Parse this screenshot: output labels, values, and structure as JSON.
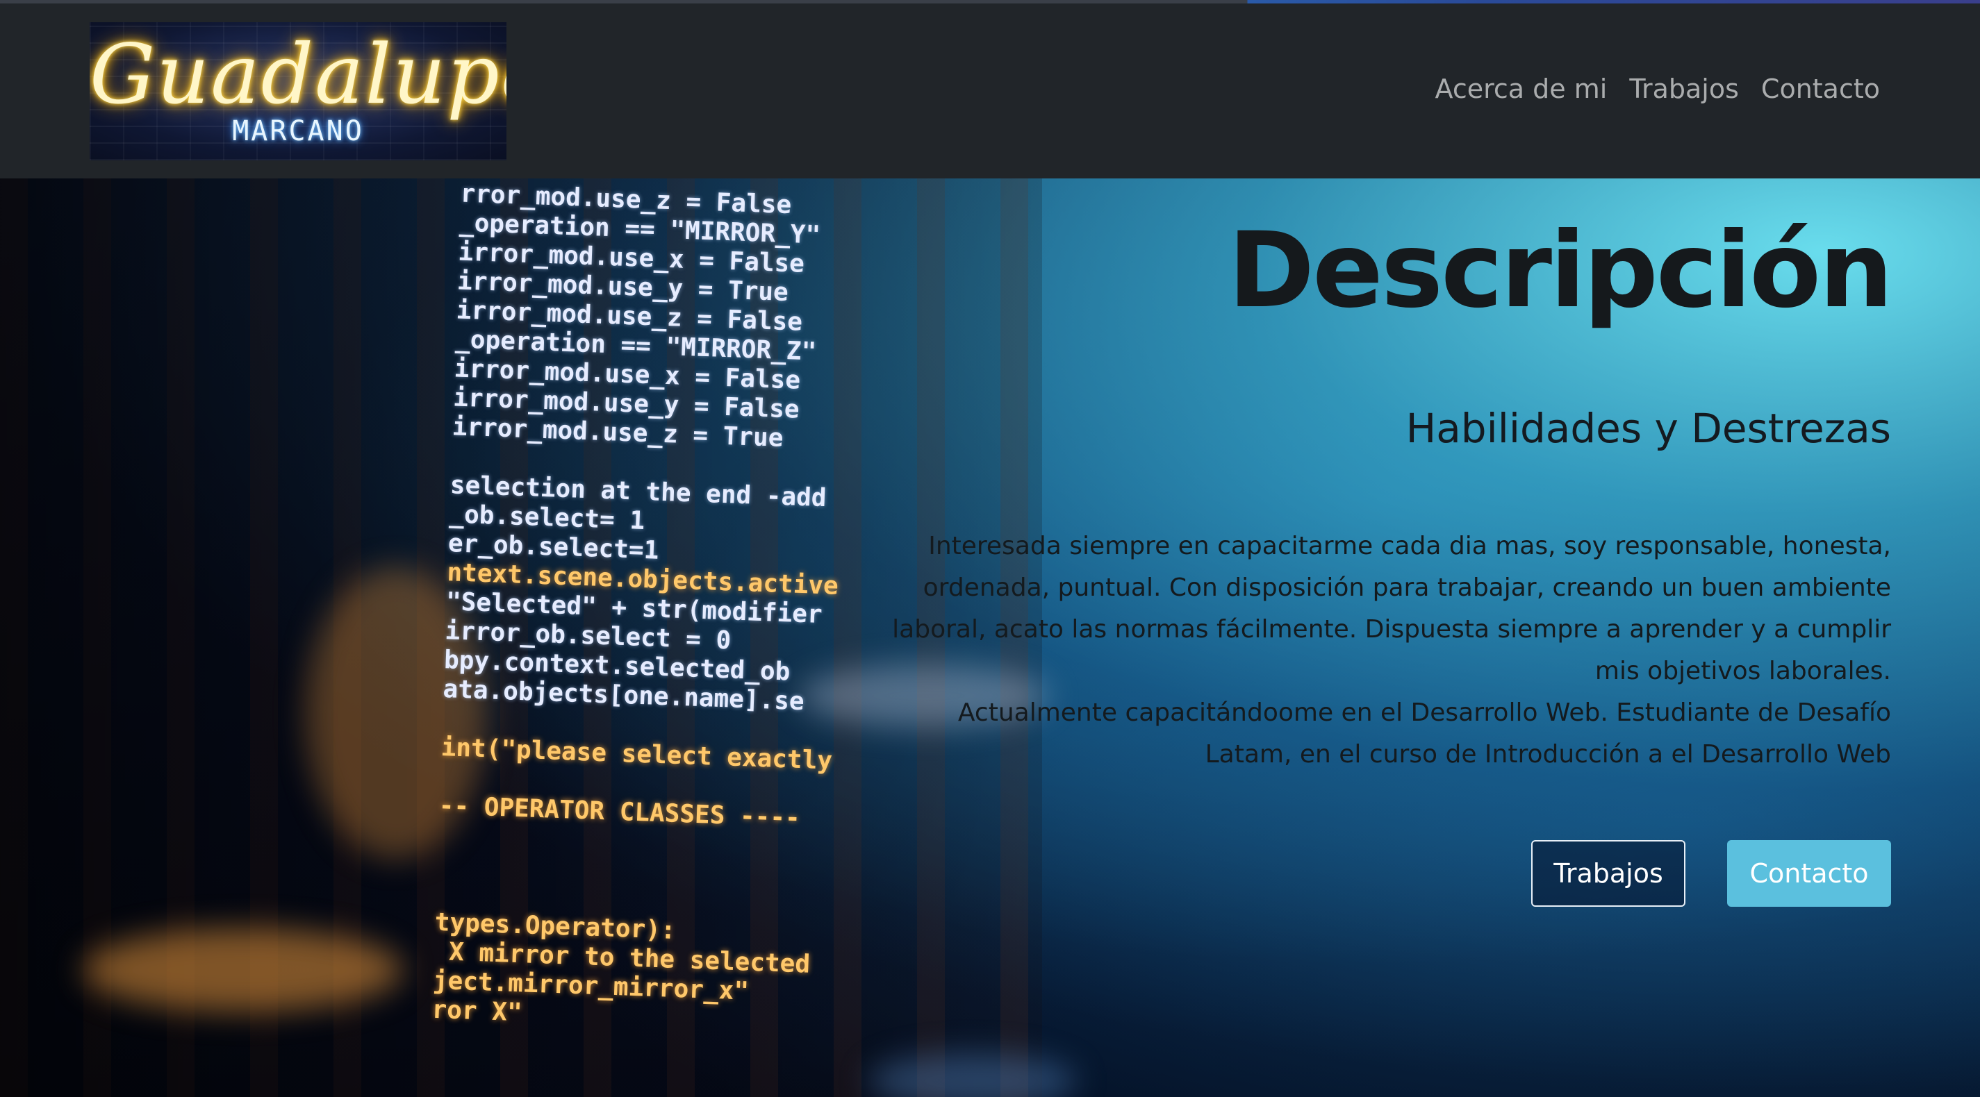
{
  "navbar": {
    "logo": {
      "script_text": "Guadalupe",
      "sub_text": "MARCANO"
    },
    "links": [
      {
        "label": "Acerca de mi"
      },
      {
        "label": "Trabajos"
      },
      {
        "label": "Contacto"
      }
    ]
  },
  "hero": {
    "title": "Descripción",
    "subtitle": "Habilidades y Destrezas",
    "paragraph_1": "Interesada siempre en capacitarme cada dia mas, soy responsable, honesta, ordenada, puntual. Con disposición para trabajar, creando un buen ambiente laboral, acato las normas fácilmente. Dispuesta siempre a aprender y a cumplir mis objetivos laborales.",
    "paragraph_2": "Actualmente capacitándoome en el Desarrollo Web. Estudiante de Desafío Latam, en el curso de Introducción a el Desarrollo Web",
    "buttons": {
      "primary_label": "Trabajos",
      "secondary_label": "Contacto"
    }
  },
  "colors": {
    "navbar_bg": "#212529",
    "nav_link": "rgba(255,255,255,0.62)",
    "button_info": "#5bc0de",
    "heading_text": "#15191c"
  },
  "icons": {
    "logo": "neon-sign-logo",
    "background": "code-screen-image"
  }
}
